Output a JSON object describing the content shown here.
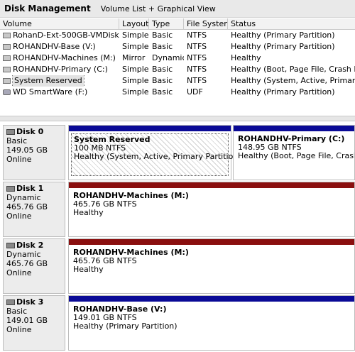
{
  "window": {
    "title": "Disk Management",
    "view": "Volume List + Graphical View"
  },
  "columns": [
    "Volume",
    "Layout",
    "Type",
    "File System",
    "Status"
  ],
  "volumes": [
    {
      "name": "RohanD-Ext-500GB-VMDisk (G:)",
      "layout": "Simple",
      "type": "Basic",
      "fs": "NTFS",
      "status": "Healthy (Primary Partition)"
    },
    {
      "name": "ROHANDHV-Base (V:)",
      "layout": "Simple",
      "type": "Basic",
      "fs": "NTFS",
      "status": "Healthy (Primary Partition)"
    },
    {
      "name": "ROHANDHV-Machines (M:)",
      "layout": "Mirror",
      "type": "Dynamic",
      "fs": "NTFS",
      "status": "Healthy"
    },
    {
      "name": "ROHANDHV-Primary (C:)",
      "layout": "Simple",
      "type": "Basic",
      "fs": "NTFS",
      "status": "Healthy (Boot, Page File, Crash Dump,"
    },
    {
      "name": "System Reserved",
      "layout": "Simple",
      "type": "Basic",
      "fs": "NTFS",
      "status": "Healthy (System, Active, Primary Partiti"
    },
    {
      "name": "WD SmartWare (F:)",
      "layout": "Simple",
      "type": "Basic",
      "fs": "UDF",
      "status": "Healthy (Primary Partition)"
    }
  ],
  "disks": [
    {
      "name": "Disk 0",
      "kind": "Basic",
      "size": "149.05 GB",
      "state": "Online",
      "partitions": [
        {
          "name": "System Reserved",
          "size": "100 MB NTFS",
          "status": "Healthy (System, Active, Primary Partition)"
        },
        {
          "name": "ROHANDHV-Primary  (C:)",
          "size": "148.95 GB NTFS",
          "status": "Healthy (Boot, Page File, Crash Dump, P"
        }
      ]
    },
    {
      "name": "Disk 1",
      "kind": "Dynamic",
      "size": "465.76 GB",
      "state": "Online",
      "partitions": [
        {
          "name": "ROHANDHV-Machines  (M:)",
          "size": "465.76 GB NTFS",
          "status": "Healthy"
        }
      ]
    },
    {
      "name": "Disk 2",
      "kind": "Dynamic",
      "size": "465.76 GB",
      "state": "Online",
      "partitions": [
        {
          "name": "ROHANDHV-Machines  (M:)",
          "size": "465.76 GB NTFS",
          "status": "Healthy"
        }
      ]
    },
    {
      "name": "Disk 3",
      "kind": "Basic",
      "size": "149.01 GB",
      "state": "Online",
      "partitions": [
        {
          "name": "ROHANDHV-Base  (V:)",
          "size": "149.01 GB NTFS",
          "status": "Healthy (Primary Partition)"
        }
      ]
    }
  ],
  "colors": {
    "primary_bar": "#0a0a96",
    "mirror_bar": "#8a0f0f"
  }
}
